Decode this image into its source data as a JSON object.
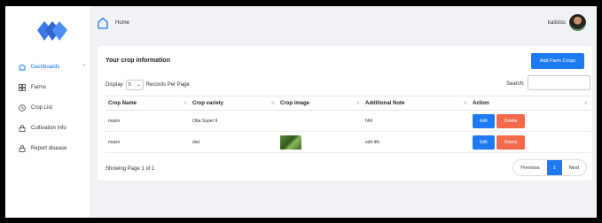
{
  "topbar": {
    "home_label": "Home",
    "user_name": "kalistos"
  },
  "sidebar": {
    "items": [
      {
        "label": "Dashboards",
        "icon": "dashboard-icon"
      },
      {
        "label": "Farms",
        "icon": "grid-icon"
      },
      {
        "label": "Crop List",
        "icon": "clock-icon"
      },
      {
        "label": "Cultivation Info",
        "icon": "lock-icon"
      },
      {
        "label": "Report disease",
        "icon": "lock-icon"
      }
    ]
  },
  "card": {
    "title": "Your crop information",
    "add_button": "Add Farm Crops",
    "display_label": "Display",
    "display_value": "5",
    "records_label": "Records Per Page",
    "search_label": "Search:",
    "search_value": "",
    "columns": [
      "Crop Name",
      "Crop variety",
      "Crop image",
      "Additional Note",
      "Action"
    ],
    "rows": [
      {
        "crop_name": "maize",
        "crop_variety": "Oba Super II",
        "has_image": false,
        "note": "hhh",
        "edit": "Edit",
        "delete": "Delete"
      },
      {
        "crop_name": "maize",
        "crop_variety": "dsd",
        "has_image": true,
        "note": "sdd dfs",
        "edit": "Edit",
        "delete": "Delete"
      }
    ],
    "showing_text": "Showing Page 1 of 1",
    "pagination": {
      "previous": "Previous",
      "current": "1",
      "next": "Next"
    }
  },
  "colors": {
    "primary": "#1d7af3",
    "danger": "#f26a4b",
    "logo": "#3a6fd8"
  }
}
